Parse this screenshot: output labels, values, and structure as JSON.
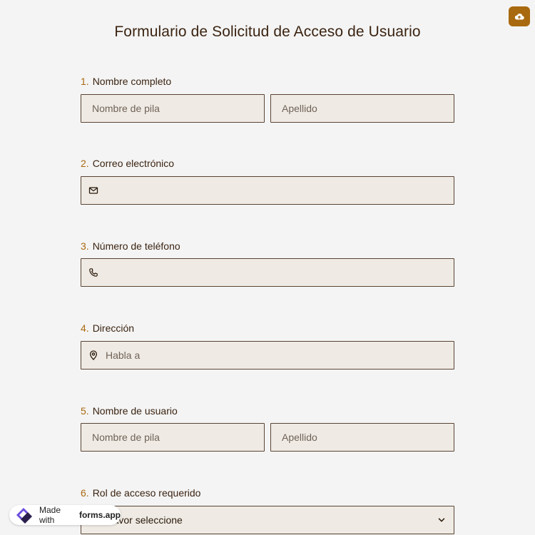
{
  "form": {
    "title": "Formulario de Solicitud de Acceso de Usuario"
  },
  "questions": [
    {
      "num": "1.",
      "label": "Nombre completo",
      "first_placeholder": "Nombre de pila",
      "last_placeholder": "Apellido"
    },
    {
      "num": "2.",
      "label": "Correo electrónico",
      "icon": "envelope-icon"
    },
    {
      "num": "3.",
      "label": "Número de teléfono",
      "icon": "phone-icon"
    },
    {
      "num": "4.",
      "label": "Dirección",
      "icon": "location-pin-icon",
      "placeholder": "Habla a"
    },
    {
      "num": "5.",
      "label": "Nombre de usuario",
      "first_placeholder": "Nombre de pila",
      "last_placeholder": "Apellido"
    },
    {
      "num": "6.",
      "label": "Rol de acceso requerido",
      "select_value": "Por favor seleccione"
    }
  ],
  "badge": {
    "made_with": "Made with",
    "brand": "forms.app"
  },
  "colors": {
    "accent": "#a9690f",
    "text": "#3b2412",
    "field_bg": "#efebe4",
    "field_border": "#5a4434",
    "page_bg": "#f4f4f4"
  },
  "icons": {
    "top_right": "cloud-upload-icon"
  }
}
